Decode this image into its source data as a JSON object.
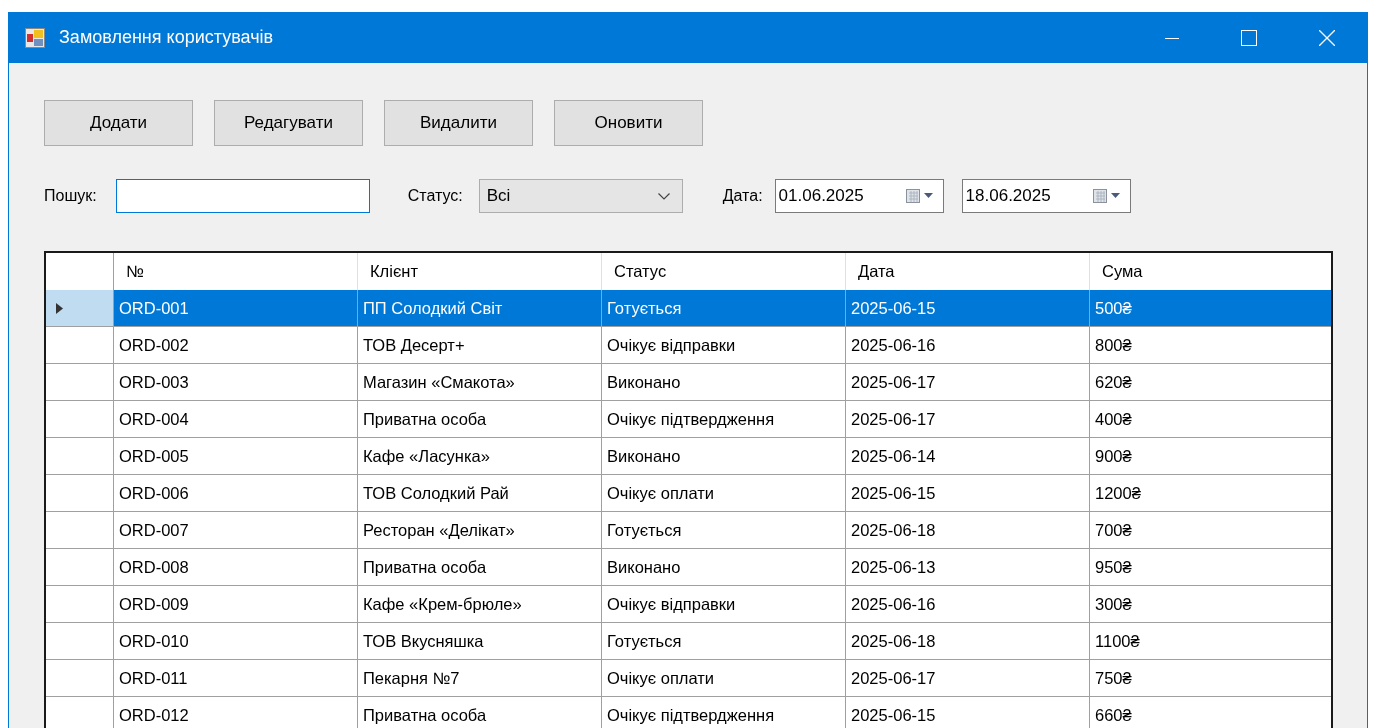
{
  "window": {
    "title": "Замовлення користувачів"
  },
  "buttons": [
    "Додати",
    "Редагувати",
    "Видалити",
    "Оновити"
  ],
  "filters": {
    "search": {
      "label": "Пошук:",
      "focused": true
    },
    "status": {
      "label": "Статус:",
      "value": "Всі"
    },
    "date": {
      "label": "Дата:",
      "from": "01.06.2025",
      "to": "18.06.2025"
    }
  },
  "table": {
    "columns": [
      "№",
      "Клієнт",
      "Статус",
      "Дата",
      "Сума"
    ],
    "rows": [
      {
        "selected": true,
        "cells": [
          "ORD-001",
          "ПП Солодкий Світ",
          "Готується",
          "2025-06-15",
          "500₴"
        ]
      },
      {
        "selected": false,
        "cells": [
          "ORD-002",
          "ТОВ Десерт+",
          "Очікує відправки",
          "2025-06-16",
          "800₴"
        ]
      },
      {
        "selected": false,
        "cells": [
          "ORD-003",
          "Магазин «Смакота»",
          "Виконано",
          "2025-06-17",
          "620₴"
        ]
      },
      {
        "selected": false,
        "cells": [
          "ORD-004",
          "Приватна особа",
          "Очікує підтвердження",
          "2025-06-17",
          "400₴"
        ]
      },
      {
        "selected": false,
        "cells": [
          "ORD-005",
          "Кафе «Ласунка»",
          "Виконано",
          "2025-06-14",
          "900₴"
        ]
      },
      {
        "selected": false,
        "cells": [
          "ORD-006",
          "ТОВ Солодкий Рай",
          "Очікує оплати",
          "2025-06-15",
          "1200₴"
        ]
      },
      {
        "selected": false,
        "cells": [
          "ORD-007",
          "Ресторан «Делікат»",
          "Готується",
          "2025-06-18",
          "700₴"
        ]
      },
      {
        "selected": false,
        "cells": [
          "ORD-008",
          "Приватна особа",
          "Виконано",
          "2025-06-13",
          "950₴"
        ]
      },
      {
        "selected": false,
        "cells": [
          "ORD-009",
          "Кафе «Крем-брюле»",
          "Очікує відправки",
          "2025-06-16",
          "300₴"
        ]
      },
      {
        "selected": false,
        "cells": [
          "ORD-010",
          "ТОВ Вкусняшка",
          "Готується",
          "2025-06-18",
          "1100₴"
        ]
      },
      {
        "selected": false,
        "cells": [
          "ORD-011",
          "Пекарня №7",
          "Очікує оплати",
          "2025-06-17",
          "750₴"
        ]
      },
      {
        "selected": false,
        "cells": [
          "ORD-012",
          "Приватна особа",
          "Очікує підтвердження",
          "2025-06-15",
          "660₴"
        ]
      }
    ]
  }
}
